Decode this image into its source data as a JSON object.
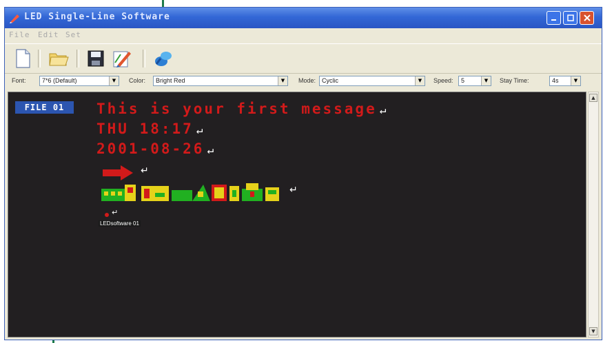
{
  "window": {
    "title": "LED Single-Line Software",
    "minimize_icon": "minimize-icon",
    "maximize_icon": "maximize-icon",
    "close_icon": "close-icon"
  },
  "menu": {
    "file": "File",
    "edit": "Edit",
    "set": "Set"
  },
  "toolbar": {
    "icons": [
      "new-file-icon",
      "open-folder-icon",
      "save-icon",
      "edit-pen-icon",
      "send-transfer-icon"
    ]
  },
  "options": {
    "font_label": "Font:",
    "font_value": "7*6 (Default)",
    "color_label": "Color:",
    "color_value": "Bright Red",
    "mode_label": "Mode:",
    "mode_value": "Cyclic",
    "speed_label": "Speed:",
    "speed_value": "5",
    "stay_label": "Stay Time:",
    "stay_value": "4s"
  },
  "editor": {
    "file_tag": "FILE 01",
    "line1": "This is your first message",
    "line2": "THU 18:17",
    "line3": "2001-08-26",
    "small_label": "LEDsoftware 01"
  },
  "colors": {
    "title_bar": "#3367d6",
    "editor_bg": "#221f21",
    "led_red": "#d21a1a",
    "led_green": "#21b021",
    "led_yellow": "#e6d21a",
    "callout": "#1e7b4c"
  }
}
